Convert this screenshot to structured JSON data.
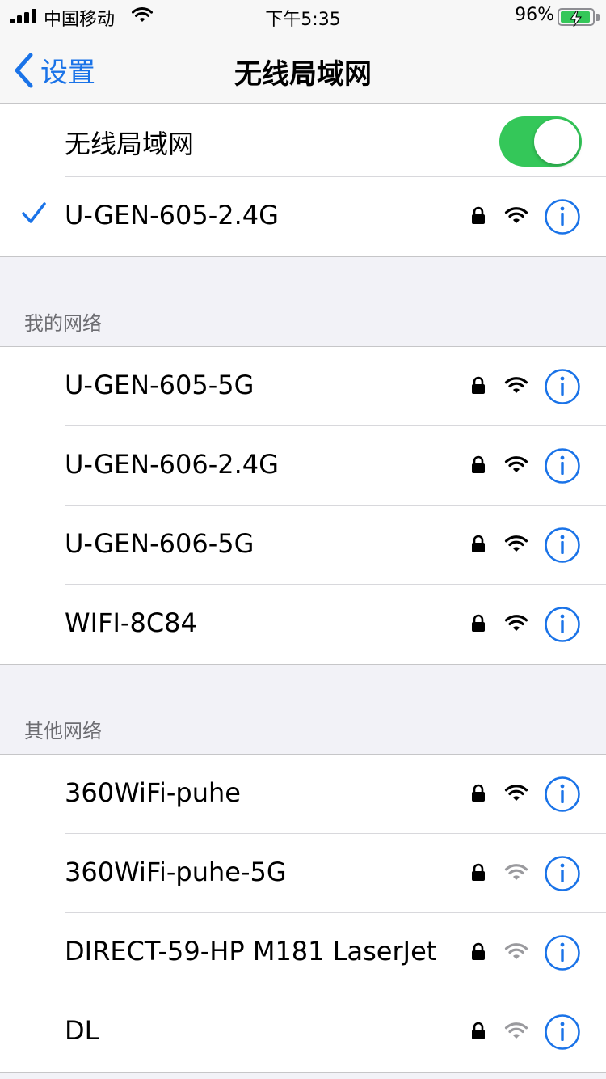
{
  "status_bar": {
    "carrier": "中国移动",
    "time": "下午5:35",
    "battery_percent": "96%",
    "battery_level": 0.96,
    "charging": true
  },
  "nav": {
    "back_label": "设置",
    "title": "无线局域网"
  },
  "wlan_toggle": {
    "label": "无线局域网",
    "on": true
  },
  "connected": {
    "name": "U-GEN-605-2.4G",
    "secured": true,
    "signal": "strong"
  },
  "my_networks": {
    "header": "我的网络",
    "items": [
      {
        "name": "U-GEN-605-5G",
        "secured": true,
        "signal": "strong"
      },
      {
        "name": "U-GEN-606-2.4G",
        "secured": true,
        "signal": "strong"
      },
      {
        "name": "U-GEN-606-5G",
        "secured": true,
        "signal": "strong"
      },
      {
        "name": "WIFI-8C84",
        "secured": true,
        "signal": "strong"
      }
    ]
  },
  "other_networks": {
    "header": "其他网络",
    "items": [
      {
        "name": "360WiFi-puhe",
        "secured": true,
        "signal": "strong"
      },
      {
        "name": "360WiFi-puhe-5G",
        "secured": true,
        "signal": "weak"
      },
      {
        "name": "DIRECT-59-HP M181 LaserJet",
        "secured": true,
        "signal": "weak"
      },
      {
        "name": "DL",
        "secured": true,
        "signal": "weak"
      }
    ]
  },
  "icons": {
    "lock": "lock-icon",
    "wifi": "wifi-signal-icon",
    "info": "info-icon",
    "check": "checkmark-icon",
    "back": "chevron-left-icon"
  },
  "colors": {
    "accent": "#1a73e8",
    "toggle_on": "#34c759",
    "background": "#f2f2f7",
    "header_text": "#6d6d72",
    "wifi_strong": "#000000",
    "wifi_weak": "#9a9a9e"
  }
}
